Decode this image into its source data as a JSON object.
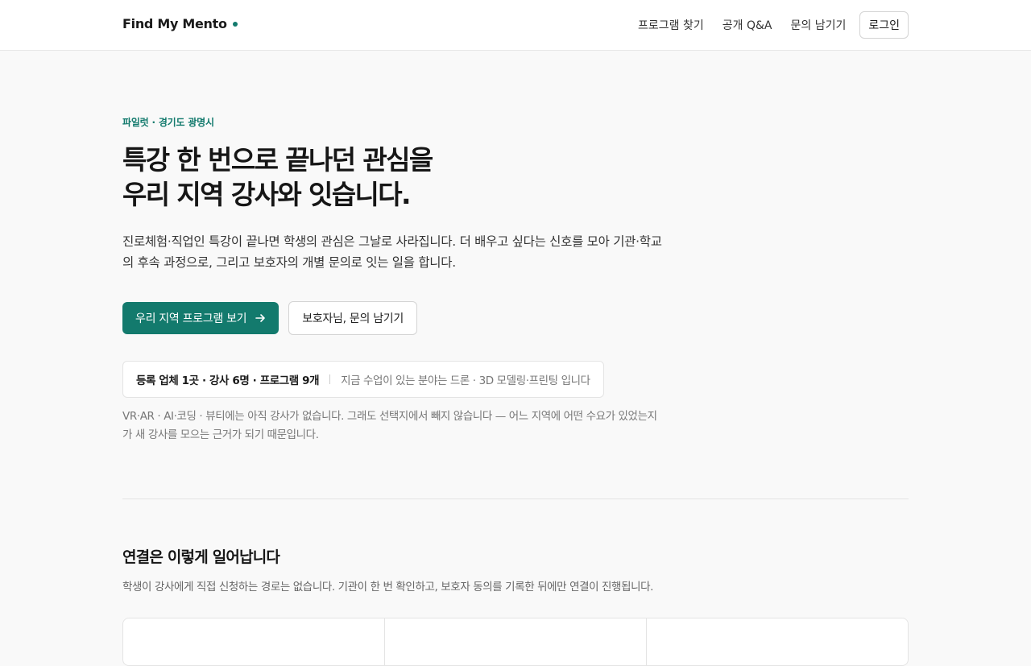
{
  "header": {
    "brand": "Find My Mento",
    "nav": [
      "프로그램 찾기",
      "공개 Q&A",
      "문의 남기기"
    ],
    "login": "로그인"
  },
  "hero": {
    "eyebrow": "파일럿 · 경기도 광명시",
    "headline_line1": "특강 한 번으로 끝나던 관심을",
    "headline_line2": "우리 지역 강사와 잇습니다.",
    "lede": "진로체험·직업인 특강이 끝나면 학생의 관심은 그날로 사라집니다. 더 배우고 싶다는 신호를 모아 기관·학교의 후속 과정으로, 그리고 보호자의 개별 문의로 잇는 일을 합니다.",
    "cta_primary": "우리 지역 프로그램 보기",
    "cta_secondary": "보호자님, 문의 남기기",
    "stats": "등록 업체 1곳 · 강사 6명 · 프로그램 9개",
    "stats_note": "지금 수업이 있는 분야는 드론 · 3D 모델링·프린팅 입니다",
    "note": "VR·AR · AI·코딩 · 뷰티에는 아직 강사가 없습니다. 그래도 선택지에서 빼지 않습니다 — 어느 지역에 어떤 수요가 있었는지가 새 강사를 모으는 근거가 되기 때문입니다."
  },
  "section": {
    "title": "연결은 이렇게 일어납니다",
    "subtitle": "학생이 강사에게 직접 신청하는 경로는 없습니다. 기관이 한 번 확인하고, 보호자 동의를 기록한 뒤에만 연결이 진행됩니다."
  },
  "colors": {
    "accent": "#137a6d",
    "background": "#f9f9f9"
  }
}
